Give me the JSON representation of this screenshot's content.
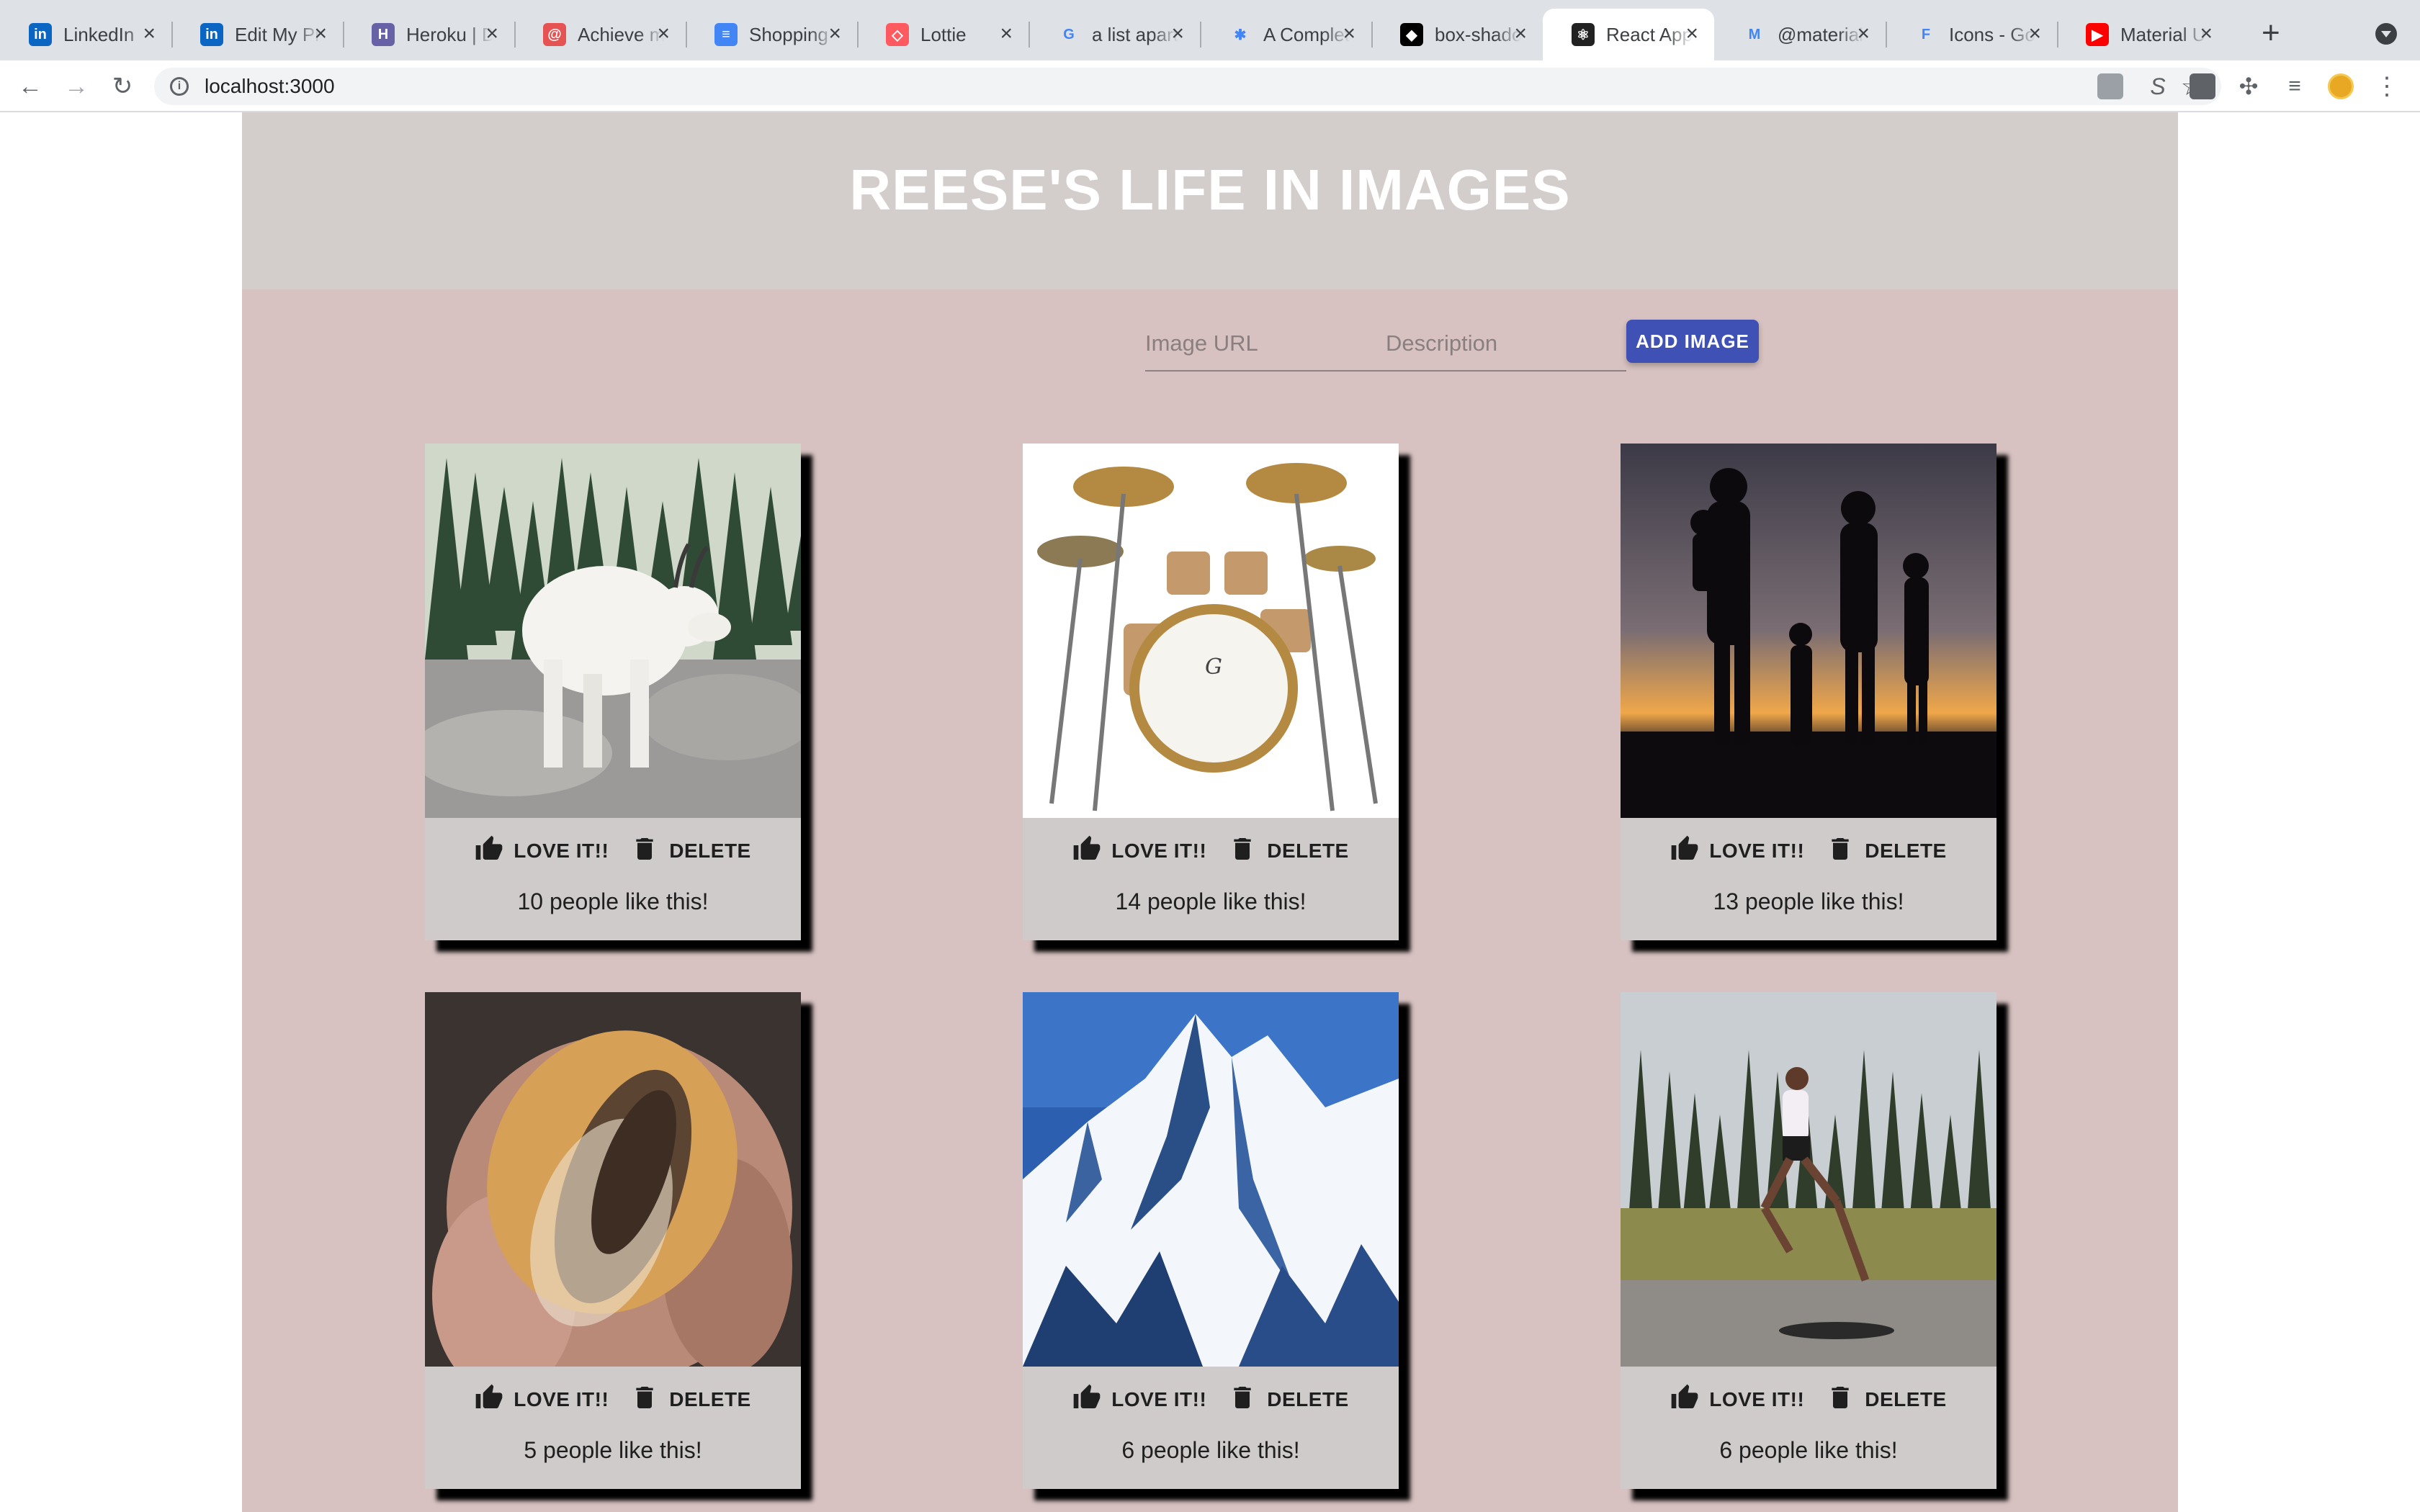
{
  "browser": {
    "tabs": [
      {
        "title": "LinkedIn",
        "icon": "linkedin-icon",
        "color": "#0a66c2",
        "glyph": "in"
      },
      {
        "title": "Edit My Profile",
        "icon": "linkedin-icon",
        "color": "#0a66c2",
        "glyph": "in"
      },
      {
        "title": "Heroku | Dashboard",
        "icon": "heroku-icon",
        "color": "#6762a6",
        "glyph": "H"
      },
      {
        "title": "Achieve more",
        "icon": "spiral-icon",
        "color": "#e55353",
        "glyph": "@"
      },
      {
        "title": "Shopping List",
        "icon": "docs-icon",
        "color": "#4285f4",
        "glyph": "≡"
      },
      {
        "title": "Lottie",
        "icon": "airbnb-icon",
        "color": "#ff5a5f",
        "glyph": "◇"
      },
      {
        "title": "a list apart",
        "icon": "google-icon",
        "color": "#ffffff",
        "glyph": "G"
      },
      {
        "title": "A Complete Guide",
        "icon": "asterisk-icon",
        "color": "#ffffff",
        "glyph": "✱"
      },
      {
        "title": "box-shadow",
        "icon": "codepen-icon",
        "color": "#000000",
        "glyph": "◆"
      },
      {
        "title": "React App",
        "icon": "react-icon",
        "color": "#222222",
        "glyph": "⚛"
      },
      {
        "title": "@material-ui",
        "icon": "material-ui-icon",
        "color": "#ffffff",
        "glyph": "M"
      },
      {
        "title": "Icons - Google Fonts",
        "icon": "google-fonts-icon",
        "color": "#ffffff",
        "glyph": "F"
      },
      {
        "title": "Material UI",
        "icon": "youtube-icon",
        "color": "#ff0000",
        "glyph": "▶"
      }
    ],
    "url": "localhost:3000"
  },
  "app": {
    "title": "REESE'S LIFE IN IMAGES",
    "form": {
      "url_placeholder": "Image URL",
      "desc_placeholder": "Description",
      "add_label": "ADD IMAGE"
    },
    "love_label": "LOVE IT!!",
    "delete_label": "DELETE",
    "cards": [
      {
        "subject": "mountain-goat",
        "likes_text": "10 people like this!"
      },
      {
        "subject": "drum-kit",
        "likes_text": "14 people like this!"
      },
      {
        "subject": "family-silhouette",
        "likes_text": "13 people like this!"
      },
      {
        "subject": "burger",
        "likes_text": "5 people like this!"
      },
      {
        "subject": "snowy-mountain",
        "likes_text": "6 people like this!"
      },
      {
        "subject": "runner",
        "likes_text": "6 people like this!"
      }
    ]
  },
  "colors": {
    "header_bg": "#d3cdcc",
    "page_bg": "#d7c2c1",
    "card_bg": "#d0cbcb",
    "button_bg": "#3f51b5"
  }
}
